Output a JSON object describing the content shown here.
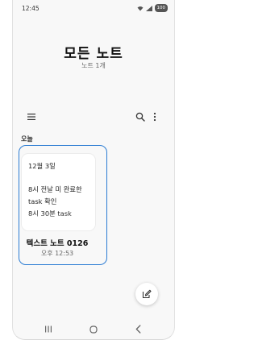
{
  "status_bar": {
    "time": "12:45",
    "battery": "100"
  },
  "header": {
    "title": "모든 노트",
    "subtitle": "노트 1개"
  },
  "toolbar": {
    "menu_icon": "menu-icon",
    "search_icon": "search-icon",
    "more_icon": "more-vert-icon"
  },
  "section": {
    "label": "오늘"
  },
  "note": {
    "preview_lines": [
      "12월 3일",
      "8시 전날 미 완료한",
      "task 확인",
      "8시 30분 task"
    ],
    "title": "텍스트 노트 0126",
    "time": "오후 12:53"
  },
  "fab": {
    "icon": "edit-icon"
  },
  "navbar": {
    "recents_icon": "recents-icon",
    "home_icon": "home-icon",
    "back_icon": "back-icon"
  },
  "colors": {
    "highlight": "#2b7cd3",
    "background": "#f8f8f8"
  }
}
